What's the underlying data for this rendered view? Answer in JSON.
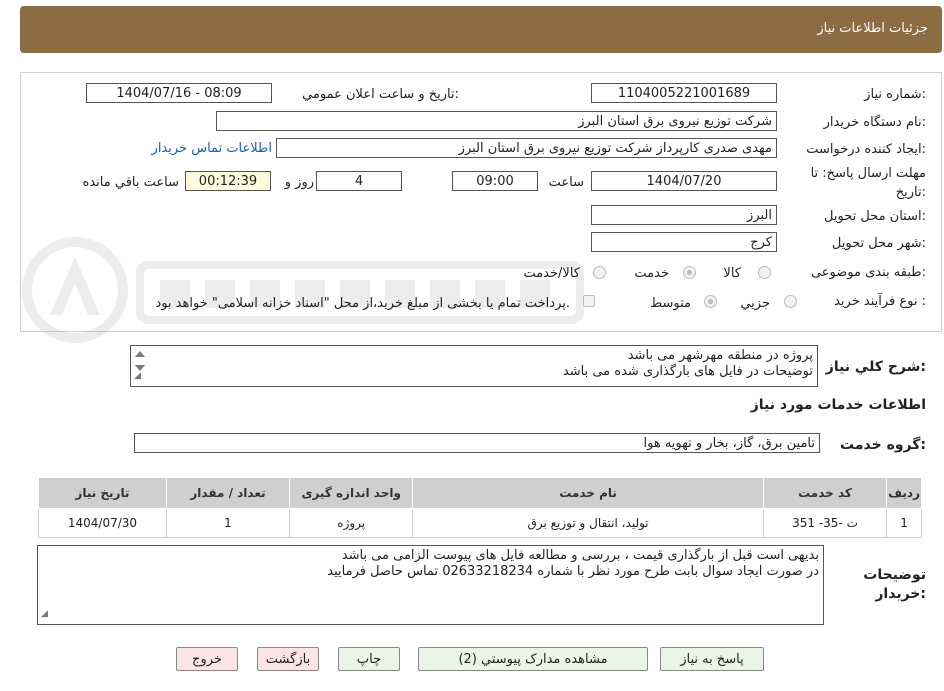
{
  "header": {
    "title": "جزئيات اطلاعات نياز"
  },
  "form": {
    "need_number_label": "شماره نياز:",
    "need_number": "1104005221001689",
    "announce_label": "تاريخ و ساعت اعلان عمومي:",
    "announce_value": "1404/07/16 - 08:09",
    "buyer_org_label": "نام دستگاه خريدار:",
    "buyer_org": "شرکت توزیع نیروی برق استان البرز",
    "requester_label": "ايجاد کننده درخواست:",
    "requester": "مهدی صدری کارپرداز شرکت توزیع نیروی برق استان البرز",
    "contact_link": "اطلاعات تماس خريدار",
    "deadline_label_1": "مهلت ارسال پاسخ: تا",
    "deadline_label_2": "تاريخ:",
    "deadline_date": "1404/07/20",
    "time_label": "ساعت",
    "deadline_time": "09:00",
    "days_value": "4",
    "days_label": "روز و",
    "remaining_value": "00:12:39",
    "remaining_label": "ساعت باقي مانده",
    "province_label": "استان محل تحويل:",
    "province": "البرز",
    "city_label": "شهر محل تحويل:",
    "city": "کرج",
    "category_label": "طبقه بندی موضوعی:",
    "category_options": [
      "کالا",
      "خدمت",
      "کالا/خدمت"
    ],
    "category_selected": "خدمت",
    "process_label": "نوع فرآيند خريد :",
    "process_options": [
      "جزيي",
      "متوسط"
    ],
    "process_selected": "متوسط",
    "payment_note": "پرداخت تمام يا بخشی از مبلغ خريد،از محل \"اسناد خزانه اسلامی\" خواهد بود."
  },
  "description": {
    "label": "شرح كلي نياز:",
    "lines": [
      "پروژه در منطقه مهرشهر می باشد",
      "توضیحات در فایل های بارگذاری شده می باشد"
    ]
  },
  "services": {
    "section_title": "اطلاعات خدمات مورد نياز",
    "group_label": "گروه خدمت:",
    "group_value": "تامين برق، گاز، بخار و تهويه هوا",
    "columns": [
      "رديف",
      "کد خدمت",
      "نام خدمت",
      "واحد اندازه گيری",
      "تعداد / مقدار",
      "تاريخ نياز"
    ],
    "rows": [
      [
        "1",
        "ت -35- 351",
        "تولید، انتقال و توزیع برق",
        "پروژه",
        "1",
        "1404/07/30"
      ]
    ]
  },
  "buyer_notes": {
    "label_1": "توضيحات",
    "label_2": "خريدار:",
    "lines": [
      "بدیهی است قبل از بارگذاری قیمت ، بررسی و مطالعه فایل های پیوست الزامی می باشد",
      "در صورت ایجاد سوال بابت طرح مورد نظر با شماره 02633218234 تماس حاصل فرمایید"
    ]
  },
  "buttons": {
    "reply": "پاسخ به نياز",
    "attachments": "مشاهده مدارک پيوستي (2)",
    "print": "چاپ",
    "back": "بازگشت",
    "exit": "خروج"
  },
  "colors": {
    "header_bg": "#8b6c43",
    "link": "#1a5fb4",
    "table_header": "#cfcfcf"
  }
}
